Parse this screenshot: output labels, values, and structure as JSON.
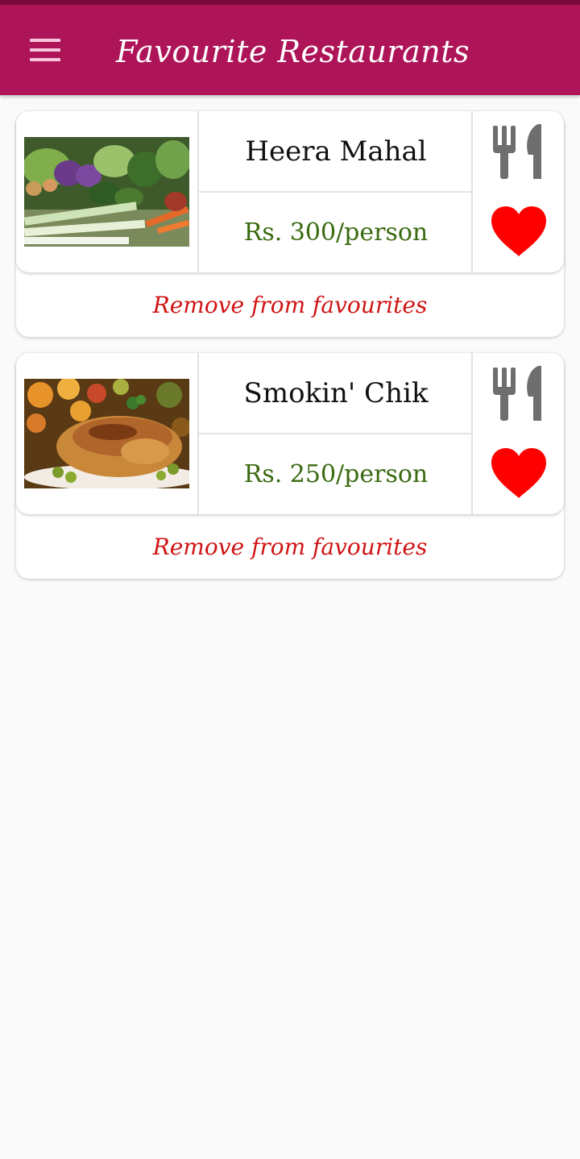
{
  "app_bar": {
    "title": "Favourite Restaurants",
    "menu_icon": "hamburger-menu-icon",
    "background_color": "#ae1458"
  },
  "restaurants": [
    {
      "name": "Heera Mahal",
      "price": "Rs. 300/person",
      "image": "vegetables-photo",
      "remove_label": "Remove from favourites",
      "category_icon": "cutlery-icon",
      "favourite_icon": "heart-icon"
    },
    {
      "name": "Smokin' Chik",
      "price": "Rs. 250/person",
      "image": "roast-chicken-photo",
      "remove_label": "Remove from favourites",
      "category_icon": "cutlery-icon",
      "favourite_icon": "heart-icon"
    }
  ],
  "colors": {
    "price": "#3a6a10",
    "remove": "#d01414",
    "heart": "#ff0000",
    "cutlery": "#6e6e6e"
  }
}
